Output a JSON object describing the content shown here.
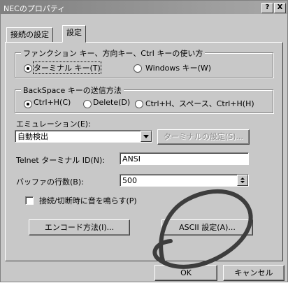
{
  "window": {
    "title": "NECのプロパティ",
    "help_label": "?",
    "close_label": "X"
  },
  "tabs": [
    {
      "label": "接続の設定"
    },
    {
      "label": "設定"
    }
  ],
  "function_keys": {
    "legend": "ファンクション キー、方向キー、Ctrl キーの使い方",
    "options": [
      {
        "label": "ターミナル キー(T)",
        "selected": true
      },
      {
        "label": "Windows キー(W)",
        "selected": false
      }
    ]
  },
  "backspace": {
    "legend": "BackSpace キーの送信方法",
    "options": [
      {
        "label": "Ctrl+H(C)",
        "selected": true
      },
      {
        "label": "Delete(D)",
        "selected": false
      },
      {
        "label": "Ctrl+H、スペース、Ctrl+H(H)",
        "selected": false
      }
    ]
  },
  "emulation": {
    "label": "エミュレーション(E):",
    "value": "自動検出",
    "terminal_settings_button": "ターミナルの設定(S)..."
  },
  "telnet": {
    "label": "Telnet ターミナル ID(N):",
    "value": "ANSI"
  },
  "buffer": {
    "label": "バッファの行数(B):",
    "value": "500"
  },
  "beep": {
    "label": "接続/切断時に音を鳴らす(P)",
    "checked": false
  },
  "encode_button": "エンコード方法(I)...",
  "ascii_button": "ASCII 設定(A)...",
  "footer": {
    "ok": "OK",
    "cancel": "キャンセル"
  },
  "colors": {
    "highlight": "#3d3d3d"
  }
}
